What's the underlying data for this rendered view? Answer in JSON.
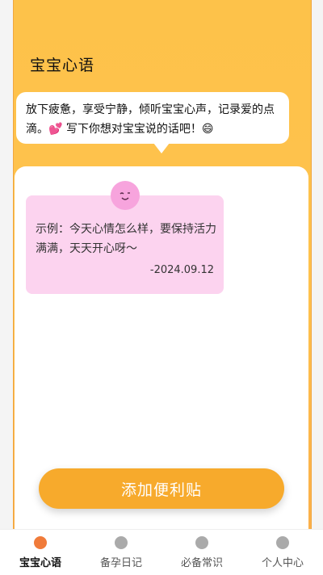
{
  "page": {
    "title": "宝宝心语"
  },
  "intro": {
    "text": "放下疲惫，享受宁静，倾听宝宝心声，记录爱的点滴。💕 写下你想对宝宝说的话吧！😄"
  },
  "note": {
    "text": "示例：今天心情怎么样，要保持活力满满，天天开心呀～",
    "date": "-2024.09.12"
  },
  "actions": {
    "add_label": "添加便利贴"
  },
  "tabbar": {
    "items": [
      {
        "label": "宝宝心语",
        "icon": "face-icon",
        "active": true
      },
      {
        "label": "备孕日记",
        "icon": "bottle-icon",
        "active": false
      },
      {
        "label": "必备常识",
        "icon": "book-icon",
        "active": false
      },
      {
        "label": "个人中心",
        "icon": "person-icon",
        "active": false
      }
    ]
  },
  "colors": {
    "accent": "#f7aa2c",
    "note_bg": "#fcd3ef",
    "active_tab": "#f07b3a"
  }
}
